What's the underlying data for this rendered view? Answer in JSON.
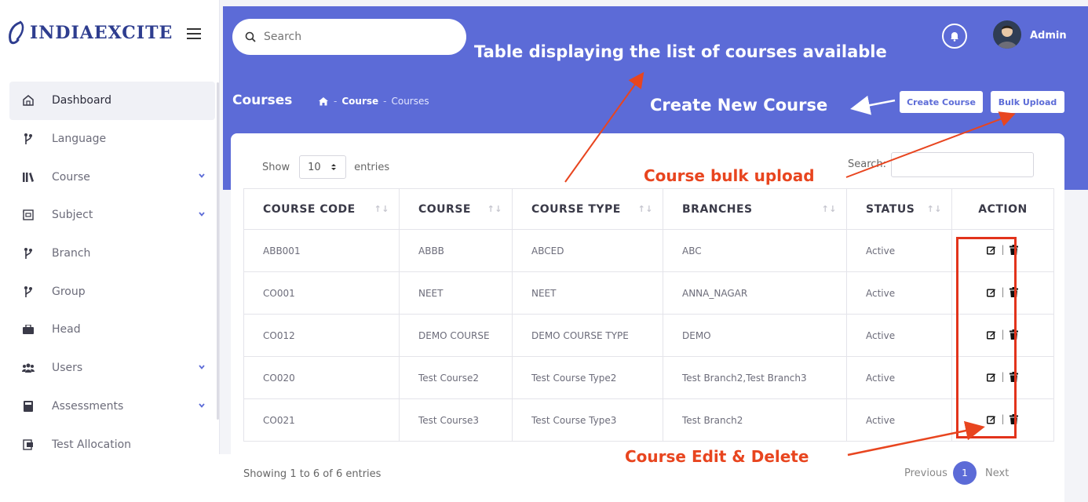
{
  "brand": {
    "name": "INDIAEXCITE"
  },
  "sidebar": {
    "items": [
      {
        "label": "Dashboard",
        "icon": "dashboard-icon",
        "expandable": false,
        "active": true
      },
      {
        "label": "Language",
        "icon": "branch-icon",
        "expandable": false
      },
      {
        "label": "Course",
        "icon": "books-icon",
        "expandable": true
      },
      {
        "label": "Subject",
        "icon": "subject-icon",
        "expandable": true
      },
      {
        "label": "Branch",
        "icon": "branch-icon",
        "expandable": false
      },
      {
        "label": "Group",
        "icon": "branch-icon",
        "expandable": false
      },
      {
        "label": "Head",
        "icon": "briefcase-icon",
        "expandable": false
      },
      {
        "label": "Users",
        "icon": "users-icon",
        "expandable": true
      },
      {
        "label": "Assessments",
        "icon": "book-icon",
        "expandable": true
      },
      {
        "label": "Test Allocation",
        "icon": "allocation-icon",
        "expandable": false
      }
    ]
  },
  "header": {
    "search_placeholder": "Search",
    "user_name": "Admin",
    "page_title": "Courses",
    "breadcrumb": [
      "Course",
      "Courses"
    ],
    "buttons": {
      "create": "Create Course",
      "bulk": "Bulk Upload"
    }
  },
  "table_controls": {
    "show_label": "Show",
    "entries_value": "10",
    "entries_label": "entries",
    "search_label": "Search:"
  },
  "table": {
    "columns": [
      "COURSE CODE",
      "COURSE",
      "COURSE TYPE",
      "BRANCHES",
      "STATUS",
      "ACTION"
    ],
    "rows": [
      [
        "ABB001",
        "ABBB",
        "ABCED",
        "ABC",
        "Active"
      ],
      [
        "CO001",
        "NEET",
        "NEET",
        "ANNA_NAGAR",
        "Active"
      ],
      [
        "CO012",
        "DEMO COURSE",
        "DEMO COURSE TYPE",
        "DEMO",
        "Active"
      ],
      [
        "CO020",
        "Test Course2",
        "Test Course Type2",
        "Test Branch2,Test Branch3",
        "Active"
      ],
      [
        "CO021",
        "Test Course3",
        "Test Course Type3",
        "Test Branch2",
        "Active"
      ]
    ]
  },
  "pagination": {
    "info": "Showing 1 to 6 of 6 entries",
    "previous": "Previous",
    "current": "1",
    "next": "Next"
  },
  "annotations": {
    "table": "Table displaying the list of courses available",
    "create": "Create New Course",
    "bulk": "Course bulk upload",
    "edit": "Course Edit & Delete"
  },
  "colors": {
    "accent": "#5c6bd7",
    "annotation_red": "#e8451f",
    "brand": "#2e3d8f"
  }
}
